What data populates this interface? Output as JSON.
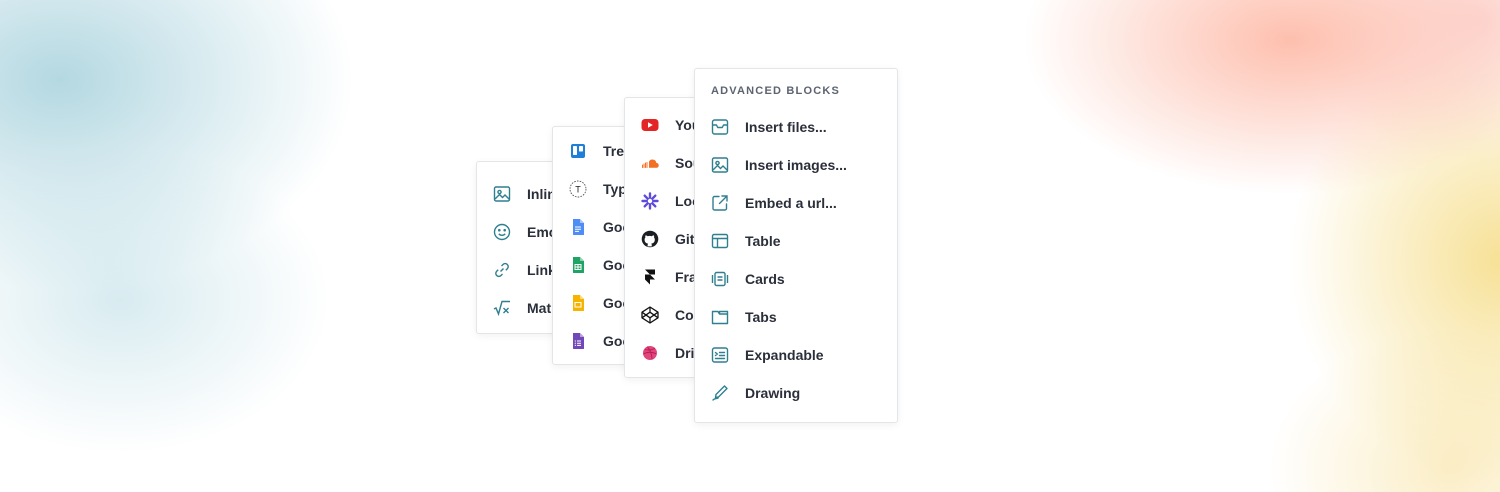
{
  "panel_inline": {
    "items": [
      {
        "label": "Inline",
        "icon": "image-icon"
      },
      {
        "label": "Emoji",
        "icon": "emoji-icon"
      },
      {
        "label": "Link",
        "icon": "link-icon"
      },
      {
        "label": "Math",
        "icon": "math-icon"
      }
    ]
  },
  "panel_apps": {
    "items": [
      {
        "label": "Trello",
        "icon": "trello-icon"
      },
      {
        "label": "Typeform",
        "icon": "typeform-icon"
      },
      {
        "label": "Google Docs",
        "icon": "google-docs-icon"
      },
      {
        "label": "Google Sheets",
        "icon": "google-sheets-icon"
      },
      {
        "label": "Google Slides",
        "icon": "google-slides-icon"
      },
      {
        "label": "Google Forms",
        "icon": "google-forms-icon"
      }
    ]
  },
  "panel_embeds": {
    "items": [
      {
        "label": "YouTube",
        "icon": "youtube-icon"
      },
      {
        "label": "SoundCloud",
        "icon": "soundcloud-icon"
      },
      {
        "label": "Loom",
        "icon": "loom-icon"
      },
      {
        "label": "GitHub",
        "icon": "github-icon"
      },
      {
        "label": "Framer",
        "icon": "framer-icon"
      },
      {
        "label": "CodePen",
        "icon": "codepen-icon"
      },
      {
        "label": "Dribbble",
        "icon": "dribbble-icon"
      }
    ]
  },
  "panel_advanced": {
    "heading": "ADVANCED BLOCKS",
    "items": [
      {
        "label": "Insert files...",
        "icon": "inbox-icon"
      },
      {
        "label": "Insert images...",
        "icon": "image-icon"
      },
      {
        "label": "Embed a url...",
        "icon": "external-link-icon"
      },
      {
        "label": "Table",
        "icon": "table-icon"
      },
      {
        "label": "Cards",
        "icon": "cards-icon"
      },
      {
        "label": "Tabs",
        "icon": "tabs-icon"
      },
      {
        "label": "Expandable",
        "icon": "expandable-icon"
      },
      {
        "label": "Drawing",
        "icon": "drawing-icon"
      }
    ]
  },
  "colors": {
    "icon_teal": "#2f7f8f",
    "text": "#2a2f3a",
    "heading": "#5c6470"
  }
}
